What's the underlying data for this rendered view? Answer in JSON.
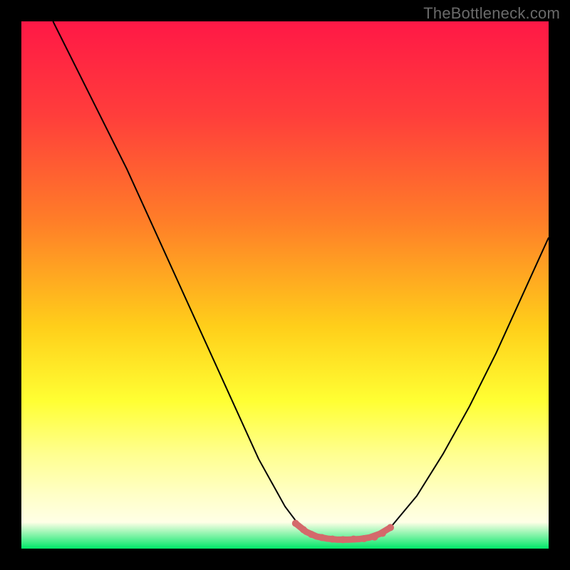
{
  "watermark": "TheBottleneck.com",
  "chart_data": {
    "type": "line",
    "title": "",
    "xlabel": "",
    "ylabel": "",
    "xlim": [
      0,
      100
    ],
    "ylim": [
      0,
      100
    ],
    "gradient_stops": [
      {
        "offset": 0.0,
        "color": "#ff1846"
      },
      {
        "offset": 0.18,
        "color": "#ff3e3b"
      },
      {
        "offset": 0.38,
        "color": "#ff7e28"
      },
      {
        "offset": 0.58,
        "color": "#ffcf1a"
      },
      {
        "offset": 0.72,
        "color": "#ffff33"
      },
      {
        "offset": 0.82,
        "color": "#ffff8f"
      },
      {
        "offset": 0.9,
        "color": "#ffffc8"
      },
      {
        "offset": 0.95,
        "color": "#ffffe6"
      },
      {
        "offset": 1.0,
        "color": "#00e768"
      }
    ],
    "series": [
      {
        "name": "curve",
        "stroke": "#000000",
        "stroke_width": 2,
        "points": [
          {
            "x": 6,
            "y": 100
          },
          {
            "x": 10,
            "y": 92
          },
          {
            "x": 15,
            "y": 82
          },
          {
            "x": 20,
            "y": 72
          },
          {
            "x": 25,
            "y": 61
          },
          {
            "x": 30,
            "y": 50
          },
          {
            "x": 35,
            "y": 39
          },
          {
            "x": 40,
            "y": 28
          },
          {
            "x": 45,
            "y": 17
          },
          {
            "x": 50,
            "y": 8
          },
          {
            "x": 53,
            "y": 4
          },
          {
            "x": 56,
            "y": 2.0
          },
          {
            "x": 60,
            "y": 1.7
          },
          {
            "x": 64,
            "y": 1.7
          },
          {
            "x": 67,
            "y": 2.2
          },
          {
            "x": 70,
            "y": 4
          },
          {
            "x": 75,
            "y": 10
          },
          {
            "x": 80,
            "y": 18
          },
          {
            "x": 85,
            "y": 27
          },
          {
            "x": 90,
            "y": 37
          },
          {
            "x": 95,
            "y": 48
          },
          {
            "x": 100,
            "y": 59
          }
        ]
      },
      {
        "name": "bottom-highlight",
        "stroke": "#d4696b",
        "stroke_width": 9,
        "linecap": "round",
        "points": [
          {
            "x": 52,
            "y": 4.8
          },
          {
            "x": 54,
            "y": 3.2
          },
          {
            "x": 56,
            "y": 2.3
          },
          {
            "x": 58,
            "y": 1.9
          },
          {
            "x": 60,
            "y": 1.7
          },
          {
            "x": 62,
            "y": 1.7
          },
          {
            "x": 64,
            "y": 1.8
          },
          {
            "x": 66,
            "y": 2.1
          },
          {
            "x": 68,
            "y": 2.8
          },
          {
            "x": 70,
            "y": 4.0
          }
        ]
      }
    ],
    "markers": [
      {
        "series": "bottom-highlight",
        "x": 52,
        "y": 4.8,
        "r": 5,
        "fill": "#d4696b"
      },
      {
        "series": "bottom-highlight",
        "x": 53.5,
        "y": 3.6,
        "r": 5,
        "fill": "#d4696b"
      },
      {
        "series": "bottom-highlight",
        "x": 55,
        "y": 2.7,
        "r": 5,
        "fill": "#d4696b"
      },
      {
        "series": "bottom-highlight",
        "x": 57,
        "y": 2.1,
        "r": 5,
        "fill": "#d4696b"
      },
      {
        "series": "bottom-highlight",
        "x": 59,
        "y": 1.8,
        "r": 5,
        "fill": "#d4696b"
      },
      {
        "series": "bottom-highlight",
        "x": 61,
        "y": 1.7,
        "r": 5,
        "fill": "#d4696b"
      },
      {
        "series": "bottom-highlight",
        "x": 63,
        "y": 1.8,
        "r": 5,
        "fill": "#d4696b"
      },
      {
        "series": "bottom-highlight",
        "x": 65,
        "y": 1.9,
        "r": 5,
        "fill": "#d4696b"
      },
      {
        "series": "bottom-highlight",
        "x": 67,
        "y": 2.2,
        "r": 5,
        "fill": "#d4696b"
      },
      {
        "series": "bottom-highlight",
        "x": 68.5,
        "y": 2.9,
        "r": 5,
        "fill": "#d4696b"
      },
      {
        "series": "bottom-highlight",
        "x": 70,
        "y": 4.0,
        "r": 5,
        "fill": "#d4696b"
      }
    ]
  }
}
